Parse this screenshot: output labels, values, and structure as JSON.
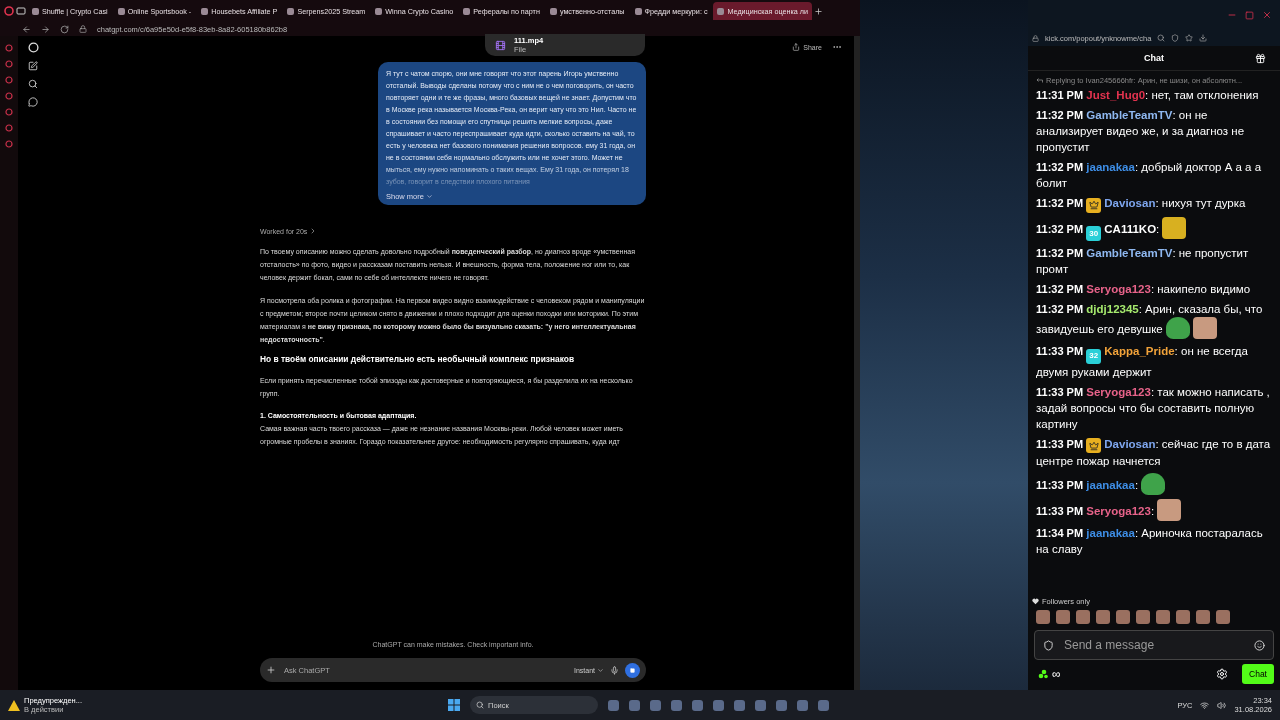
{
  "browser": {
    "tabs": [
      {
        "label": "Shuffle | Crypto Casi",
        "selected": false
      },
      {
        "label": "Online Sportsbook - ",
        "selected": false
      },
      {
        "label": "Housebets Affiliate P",
        "selected": false
      },
      {
        "label": "Serpens2025 Stream",
        "selected": false
      },
      {
        "label": "Winna Crypto Casino",
        "selected": false
      },
      {
        "label": "Рефералы по партн",
        "selected": false
      },
      {
        "label": "умственно-отсталы",
        "selected": false
      },
      {
        "label": "Фредди меркури: с",
        "selected": false
      },
      {
        "label": "Медицинская оценка ли",
        "selected": true
      }
    ],
    "url": "chatgpt.com/c/6a95e50d-e5f8-83eb-8a82-605180b862b8"
  },
  "chatgpt": {
    "share": "Share",
    "attachment": {
      "name": "111.mp4",
      "type": "File"
    },
    "user_message": "Я тут с чатом спорю, они мне говорят что этот парень Игорь умственно отсталый. Выводы сделаны потому что с ним не о чем поговорить, он часто повторяет одни и те же фразы, много базовых вещей не знает. Допустим что в Москве река называется Москва-Река, он верит чату что это Нил. Часто не в состоянии без помощи его спутницы решить мелкие вопросы, даже спрашивает и часто переспрашивает куда идти, сколько оставить на чай, то есть у человека нет базового понимания решения вопросов. ему 31 года, он не в состоянии себя нормально обслужить или не хочет этого. Может не мыться, ему нужно напоминать о таких вещах. Ему 31 года, он потерял 18 зубов, говорит в следствии плохого питания",
    "show_more": "Show more",
    "worked_for": "Worked for 20s",
    "answer": [
      {
        "kind": "paragraph",
        "text": "По твоему описанию можно сделать довольно подробный **поведенческий разбор**, но диагноз вроде «умственная отсталость» по фото, видео и рассказам поставить нельзя. И внешность, форма тела, положение ног или то, как человек держит бокал, сами по себе об интеллекте ничего не говорят."
      },
      {
        "kind": "paragraph",
        "text": "Я посмотрела оба ролика и фотографии. На первом видео видно взаимодействие с человеком рядом и манипуляции с предметом; второе почти целиком снято в движении и плохо подходит для оценки походки или моторики. По этим материалам я **не вижу признака, по которому можно было бы визуально сказать: \"у него интеллектуальная недостаточность\"**."
      },
      {
        "kind": "heading",
        "text": "Но в твоём описании действительно есть необычный комплекс признаков"
      },
      {
        "kind": "paragraph",
        "text": "Если принять перечисленные тобой эпизоды как достоверные и повторяющиеся, я бы разделила их на несколько групп."
      },
      {
        "kind": "list_item",
        "title": "1. Самостоятельность и бытовая адаптация.",
        "text": "Самая важная часть твоего рассказа — даже не незнание названия Москвы-реки. Любой человек может иметь огромные пробелы в знаниях. Гораздо показательнее другое: необходимость регулярно спрашивать, куда идт"
      }
    ],
    "disclaimer": "ChatGPT can make mistakes. Check important info.",
    "composer": {
      "placeholder": "Ask ChatGPT",
      "mode": "Instant"
    }
  },
  "kick": {
    "url": "kick.com/popout/ynknowme/cha",
    "title": "Chat",
    "reply_line": "Replying to Ivan245666hfr: Арин, не шизи, он абсолютн...",
    "messages": [
      {
        "time": "11:31 PM",
        "user": "Just_Hug0",
        "color": "#e2334f",
        "text": "нет, там отклонения"
      },
      {
        "time": "11:32 PM",
        "user": "GambleTeamTV",
        "color": "#8fb8f0",
        "text": "он не анализирует видео же, и за диагноз не пропустит"
      },
      {
        "time": "11:32 PM",
        "user": "jaanakaa",
        "color": "#3e8ee6",
        "text": "добрый доктор А а а а болит"
      },
      {
        "time": "11:32 PM",
        "user": "Daviosan",
        "color": "#7ea6ee",
        "badge": {
          "kind": "crown"
        },
        "text": "нихуя тут дурка"
      },
      {
        "time": "11:32 PM",
        "user": "CA111KO",
        "color": "#ffffff",
        "badge": {
          "kind": "sub",
          "label": "30"
        },
        "emotes": [
          {
            "kind": "goldface"
          }
        ]
      },
      {
        "time": "11:32 PM",
        "user": "GambleTeamTV",
        "color": "#8fb8f0",
        "text": "не пропустит промт"
      },
      {
        "time": "11:32 PM",
        "user": "Seryoga123",
        "color": "#e8638a",
        "text": "накипело видимо"
      },
      {
        "time": "11:32 PM",
        "user": "djdj12345",
        "color": "#a6ea6e",
        "text": "Арин, сказала бы, что завидуешь его девушке",
        "emotes": [
          {
            "kind": "frog"
          },
          {
            "kind": "face"
          }
        ]
      },
      {
        "time": "11:33 PM",
        "user": "Kappa_Pride",
        "color": "#f2a33a",
        "badge": {
          "kind": "sub",
          "label": "32"
        },
        "text": "он не всегда двумя руками держит"
      },
      {
        "time": "11:33 PM",
        "user": "Seryoga123",
        "color": "#e8638a",
        "text": "так можно написать , задай вопросы что бы составить полную картину"
      },
      {
        "time": "11:33 PM",
        "user": "Daviosan",
        "color": "#7ea6ee",
        "badge": {
          "kind": "crown"
        },
        "text": "сейчас где то в дата центре пожар начнется"
      },
      {
        "time": "11:33 PM",
        "user": "jaanakaa",
        "color": "#3e8ee6",
        "emotes": [
          {
            "kind": "frog"
          }
        ]
      },
      {
        "time": "11:33 PM",
        "user": "Seryoga123",
        "color": "#e8638a",
        "emotes": [
          {
            "kind": "face"
          }
        ]
      },
      {
        "time": "11:34 PM",
        "user": "jaanakaa",
        "color": "#3e8ee6",
        "text": "Ариночка постаралась на славу"
      }
    ],
    "separator": ":",
    "followers_only": "Followers only",
    "input_placeholder": "Send a message",
    "infinity": "∞",
    "chat_button": "Chat"
  },
  "taskbar": {
    "notification": {
      "title": "Предупрежден...",
      "subtitle": "В действии"
    },
    "search": "Поиск",
    "language": "РУС",
    "time": "23:34",
    "date": "31.08.2026"
  }
}
